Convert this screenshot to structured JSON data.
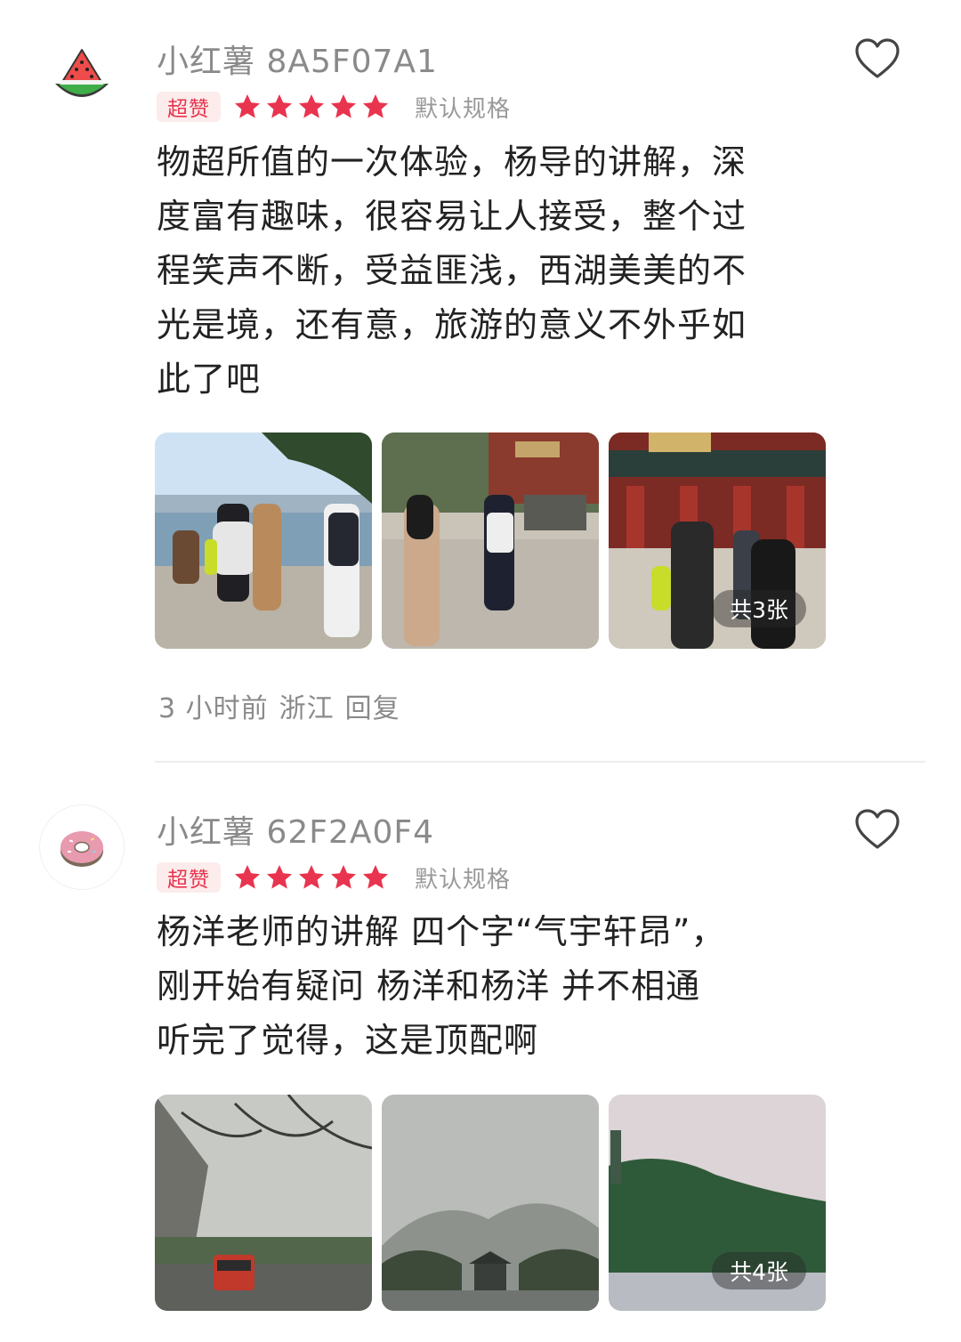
{
  "reviews": [
    {
      "username": "小红薯 8A5F07A1",
      "avatar_icon": "watermelon-icon",
      "badge": "超赞",
      "rating": 5,
      "spec": "默认规格",
      "content_lines": [
        "物超所值的一次体验，杨导的讲解，深",
        "度富有趣味，很容易让人接受，整个过",
        "程笑声不断，受益匪浅，西湖美美的不",
        "光是境，还有意，旅游的意义不外乎如",
        "此了吧"
      ],
      "photo_count_label": "共3张",
      "time": "3 小时前",
      "location": "浙江",
      "reply_label": "回复"
    },
    {
      "username": "小红薯 62F2A0F4",
      "avatar_icon": "donut-icon",
      "badge": "超赞",
      "rating": 5,
      "spec": "默认规格",
      "content_lines": [
        "杨洋老师的讲解 四个字“气宇轩昂”，",
        "刚开始有疑问 杨洋和杨洋 并不相通",
        "听完了觉得，这是顶配啊"
      ],
      "photo_count_label": "共4张"
    }
  ],
  "colors": {
    "accent": "#e8344e",
    "badge_bg": "#fdecec",
    "muted": "#8a8a8a"
  }
}
